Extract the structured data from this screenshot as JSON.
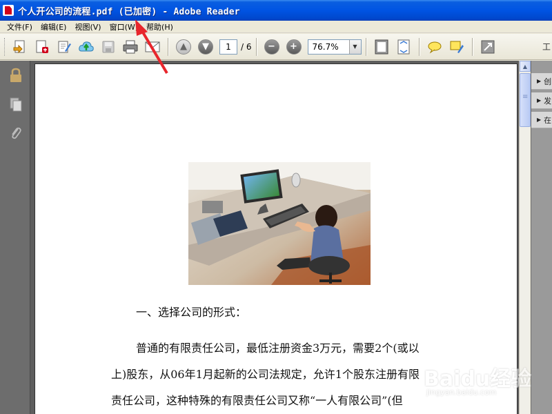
{
  "window": {
    "title": "个人开公司的流程.pdf  (已加密)  - Adobe Reader"
  },
  "menu": [
    {
      "label": "文件(F)"
    },
    {
      "label": "编辑(E)"
    },
    {
      "label": "视图(V)"
    },
    {
      "label": "窗口(W)"
    },
    {
      "label": "帮助(H)"
    }
  ],
  "toolbar": {
    "page_current": "1",
    "page_total": "/ 6",
    "zoom": "76.7%",
    "minus": "−",
    "plus": "+",
    "edge_char": "工"
  },
  "icons": {
    "create": "create-pdf-icon",
    "open": "open-icon",
    "edit": "edit-icon",
    "upload": "upload-icon",
    "save": "save-icon",
    "print": "print-icon",
    "email": "email-icon",
    "prev_page": "arrow-up-icon",
    "next_page": "arrow-down-icon",
    "fit_page": "fit-page-icon",
    "fit_width": "fit-width-icon",
    "comment": "comment-icon",
    "highlight": "highlight-icon",
    "expand": "expand-icon",
    "lock": "lock-icon",
    "pages": "pages-icon",
    "attachment": "paperclip-icon"
  },
  "document": {
    "heading": "一、选择公司的形式：",
    "lines": [
      "普通的有限责任公司，最低注册资金3万元，需要2个(或以",
      "上)股东，从06年1月起新的公司法规定，允许1个股东注册有限",
      "责任公司，这种特殊的有限责任公司又称“一人有限公司”(但"
    ]
  },
  "right_panel": [
    {
      "label": "创"
    },
    {
      "label": "发"
    },
    {
      "label": "在"
    }
  ],
  "watermark": {
    "text": "Baidu经验",
    "url": "jingyan.baidu.com"
  },
  "colors": {
    "titlebar": "#0054e3",
    "annotation_arrow": "#e8262c"
  }
}
